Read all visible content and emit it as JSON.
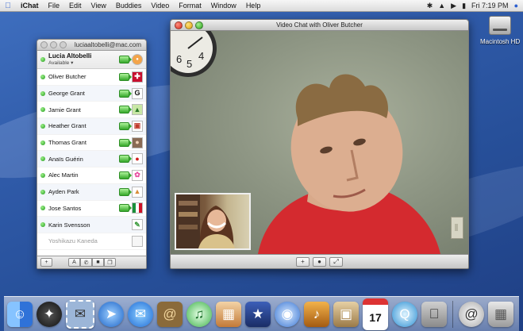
{
  "menubar": {
    "apple_icon": "apple-icon",
    "items": [
      "iChat",
      "File",
      "Edit",
      "View",
      "Buddies",
      "Video",
      "Format",
      "Window",
      "Help"
    ],
    "clock": "Fri 7:19 PM",
    "status_icons": [
      "bluetooth-icon",
      "wifi-icon",
      "volume-icon",
      "battery-icon",
      "spotlight-icon"
    ]
  },
  "desktop": {
    "hd_label": "Macintosh HD"
  },
  "buddy_list": {
    "title": "luciaaltobelli@mac.com",
    "me": {
      "name": "Lucia Altobelli",
      "status": "Available"
    },
    "buddies": [
      {
        "name": "Oliver Butcher",
        "picture": "uk-flag-icon",
        "status": "available",
        "video": true
      },
      {
        "name": "George Grant",
        "picture": "letter-g-icon",
        "status": "available",
        "video": true
      },
      {
        "name": "Jamie Grant",
        "picture": "cactus-icon",
        "status": "available",
        "video": true
      },
      {
        "name": "Heather Grant",
        "picture": "sign-icon",
        "status": "available",
        "video": true
      },
      {
        "name": "Thomas Grant",
        "picture": "person-icon",
        "status": "available",
        "video": true
      },
      {
        "name": "Anaïs Guérin",
        "picture": "apple-fruit-icon",
        "status": "available",
        "video": true
      },
      {
        "name": "Alec Martin",
        "picture": "pink-flower-icon",
        "status": "available",
        "video": true
      },
      {
        "name": "Ayden Park",
        "picture": "cake-icon",
        "status": "available",
        "video": true
      },
      {
        "name": "Jose Santos",
        "picture": "mexico-flag-icon",
        "status": "available",
        "video": true
      },
      {
        "name": "Karin Svensson",
        "picture": "sticker-icon",
        "status": "available",
        "video": false
      },
      {
        "name": "Yoshikazu Kaneda",
        "picture": "blank-icon",
        "status": "offline",
        "video": false
      }
    ]
  },
  "video_chat": {
    "title": "Video Chat with Oliver Butcher",
    "controls": [
      "+",
      "mic",
      "fullscreen"
    ]
  },
  "dock": {
    "apps": [
      "finder-icon",
      "dashboard-icon",
      "mail-stamp-icon",
      "safari-icon",
      "ichat-icon",
      "address-book-icon",
      "itunes-icon",
      "iphoto-icon",
      "imovie-icon",
      "idvd-icon",
      "garageband-icon",
      "preview-icon",
      "ical-icon",
      "quicktime-icon",
      "system-preferences-icon"
    ],
    "calendar_day": "17",
    "right": [
      "mail-at-icon",
      "trash-icon"
    ]
  }
}
